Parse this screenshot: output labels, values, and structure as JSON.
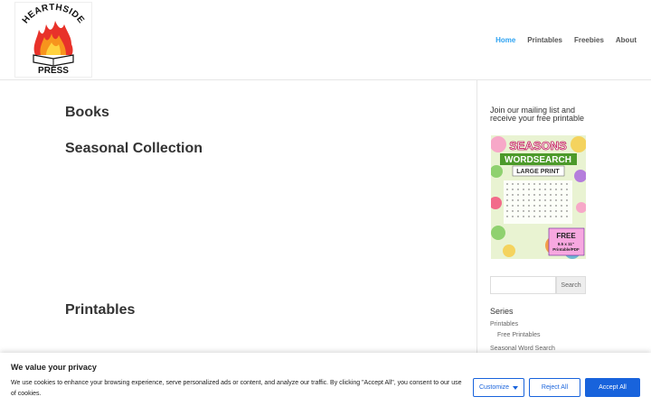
{
  "header": {
    "logo": {
      "top_text": "HEARTHSIDE",
      "bottom_text": "PRESS"
    },
    "nav": [
      {
        "label": "Home",
        "active": true
      },
      {
        "label": "Printables",
        "active": false
      },
      {
        "label": "Freebies",
        "active": false
      },
      {
        "label": "About",
        "active": false
      }
    ]
  },
  "main": {
    "heading_books": "Books",
    "heading_seasonal": "Seasonal Collection",
    "heading_printables": "Printables"
  },
  "sidebar": {
    "mailing_title": "Join our mailing list and receive your free printable",
    "promo": {
      "title": "SEASONS",
      "subtitle": "WORDSEARCH",
      "tag": "LARGE PRINT",
      "badge_line1": "FREE",
      "badge_line2": "8.5 x 11\"",
      "badge_line3": "Printable/PDF"
    },
    "search": {
      "placeholder": "",
      "button_label": "Search"
    },
    "series_title": "Series",
    "series_items": [
      {
        "label": "Printables"
      },
      {
        "label": "Free Printables"
      },
      {
        "label": "Seasonal Word Search"
      }
    ]
  },
  "cookie": {
    "title": "We value your privacy",
    "text": "We use cookies to enhance your browsing experience, serve personalized ads or content, and analyze our traffic. By clicking \"Accept All\", you consent to our use of cookies.",
    "customize_label": "Customize",
    "reject_label": "Reject All",
    "accept_label": "Accept All"
  },
  "colors": {
    "accent": "#2ea3f2",
    "cookie_blue": "#1863dc"
  }
}
